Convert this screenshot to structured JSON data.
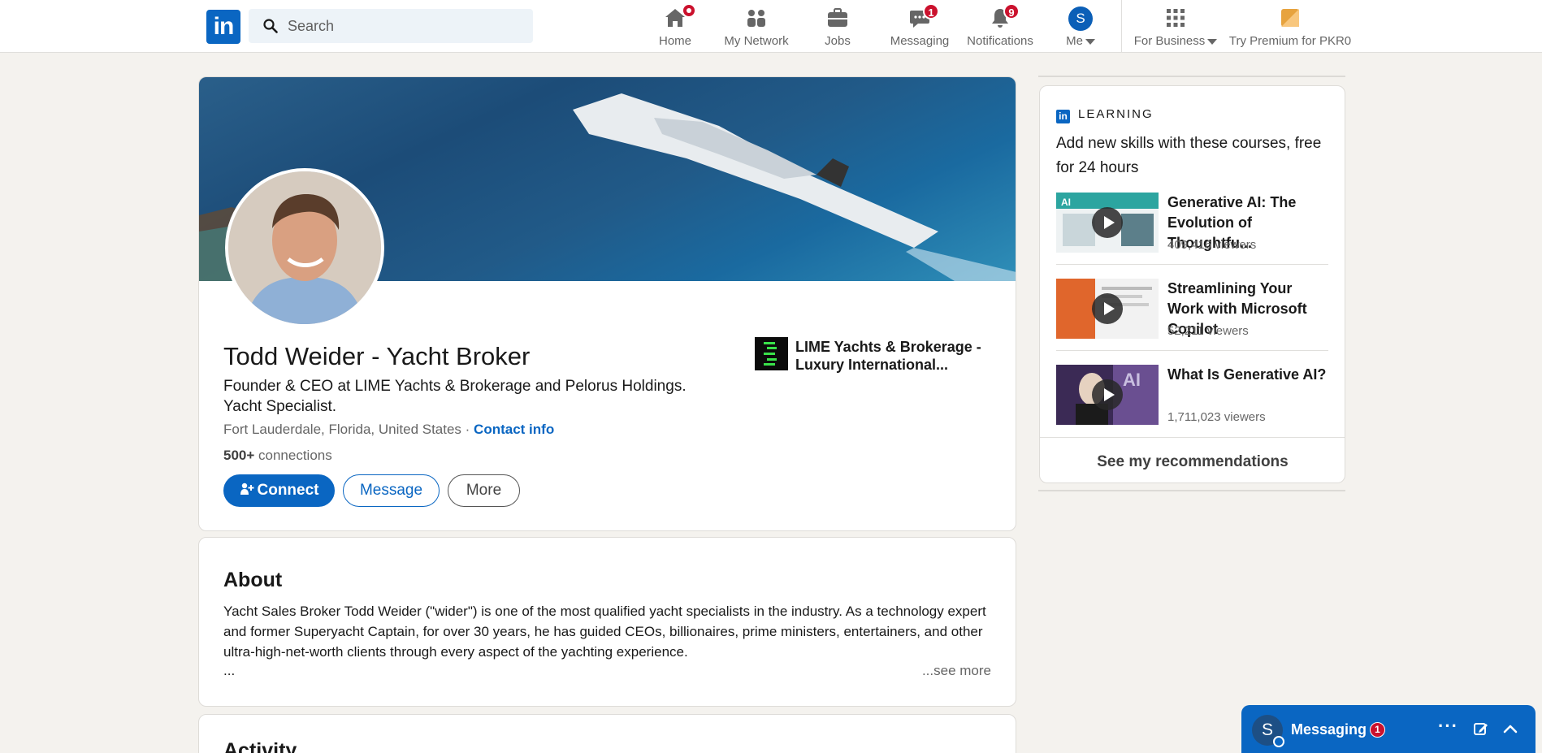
{
  "nav": {
    "logo_text": "in",
    "search_placeholder": "Search",
    "items": [
      {
        "id": "home",
        "label": "Home",
        "badge": "",
        "dot": true
      },
      {
        "id": "network",
        "label": "My Network",
        "badge": ""
      },
      {
        "id": "jobs",
        "label": "Jobs",
        "badge": ""
      },
      {
        "id": "messaging",
        "label": "Messaging",
        "badge": "1"
      },
      {
        "id": "notifications",
        "label": "Notifications",
        "badge": "9"
      },
      {
        "id": "me",
        "label": "Me",
        "avatar_letter": "S"
      },
      {
        "id": "business",
        "label": "For Business"
      },
      {
        "id": "premium",
        "label": "Try Premium for PKR0"
      }
    ]
  },
  "profile": {
    "name": "Todd Weider - Yacht Broker",
    "headline": "Founder & CEO at LIME Yachts & Brokerage and Pelorus Holdings. Yacht Specialist.",
    "location": "Fort Lauderdale, Florida, United States",
    "separator": " · ",
    "contact_info": "Contact info",
    "connections_count": "500+",
    "connections_label": " connections",
    "connect_label": "Connect",
    "message_label": "Message",
    "more_label": "More",
    "company_name": "LIME Yachts & Brokerage - Luxury International..."
  },
  "about": {
    "title": "About",
    "text": "Yacht Sales Broker Todd Weider (\"wider\") is one of the most qualified yacht specialists in the industry. As a technology expert and former Superyacht Captain, for over 30 years, he has guided CEOs, billionaires, prime ministers, entertainers, and other ultra-high-net-worth clients through every aspect of the yachting experience.",
    "ellipsis": "...",
    "see_more": "...see more"
  },
  "activity": {
    "title": "Activity"
  },
  "learning": {
    "heading": "LEARNING",
    "logo_mini": "in",
    "subtitle": "Add new skills with these courses, free for 24 hours",
    "courses": [
      {
        "title": "Generative AI: The Evolution of Thoughtfu...",
        "viewers": "409,416 viewers"
      },
      {
        "title": "Streamlining Your Work with Microsoft Copilot",
        "viewers": "52,211 viewers"
      },
      {
        "title": "What Is Generative AI?",
        "viewers": "1,711,023 viewers"
      }
    ],
    "recommendations": "See my recommendations"
  },
  "messaging_bar": {
    "avatar_letter": "S",
    "title": "Messaging",
    "badge": "1",
    "dots": "···"
  },
  "colors": {
    "brand": "#0a66c2",
    "badge": "#cb112d",
    "background": "#f4f2ee"
  }
}
